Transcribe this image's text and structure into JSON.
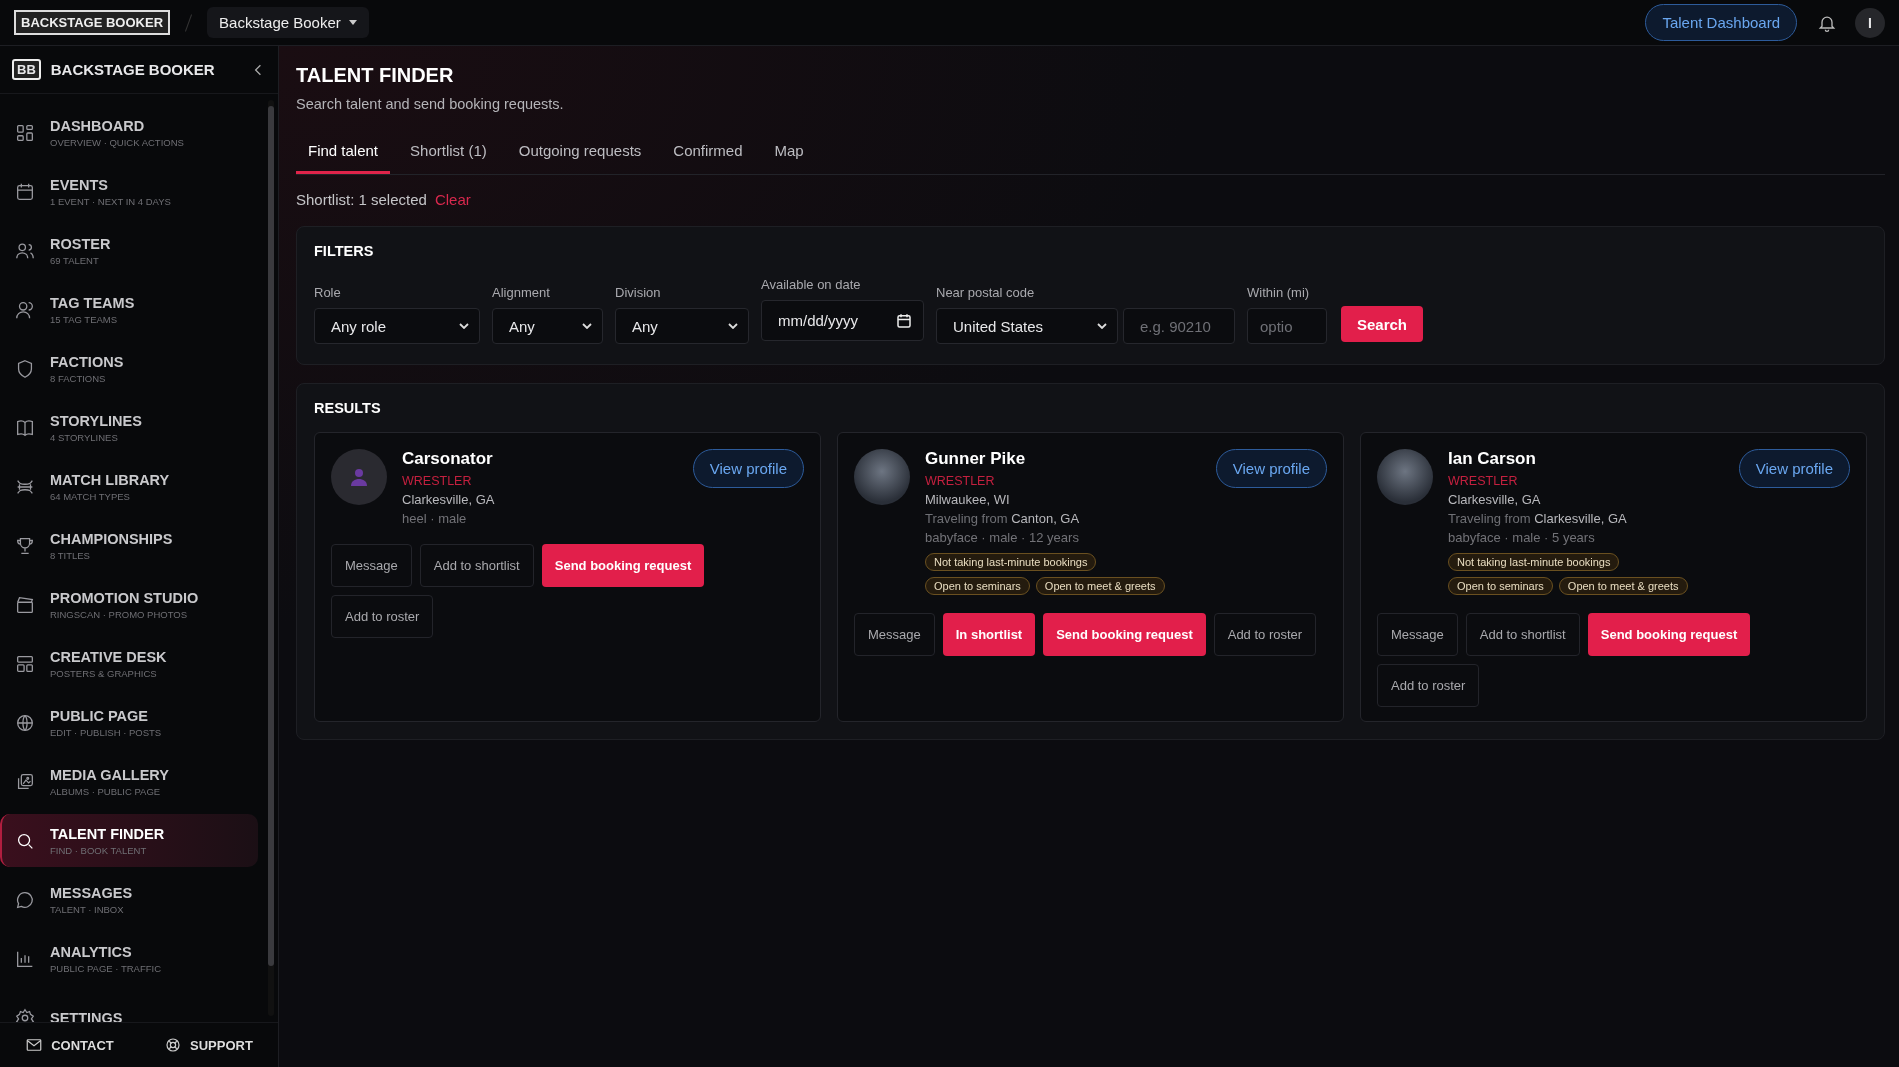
{
  "topbar": {
    "logo": "BACKSTAGE BOOKER",
    "workspace": "Backstage Booker",
    "dashboard_button": "Talent Dashboard",
    "avatar_initial": "I"
  },
  "sidebar": {
    "badge": "BB",
    "brand": "BACKSTAGE BOOKER",
    "items": [
      {
        "title": "DASHBOARD",
        "sub": "OVERVIEW · QUICK ACTIONS",
        "selected": false
      },
      {
        "title": "EVENTS",
        "sub": "1 EVENT · NEXT IN 4 DAYS",
        "selected": false
      },
      {
        "title": "ROSTER",
        "sub": "69 TALENT",
        "selected": false
      },
      {
        "title": "TAG TEAMS",
        "sub": "15 TAG TEAMS",
        "selected": false
      },
      {
        "title": "FACTIONS",
        "sub": "8 FACTIONS",
        "selected": false
      },
      {
        "title": "STORYLINES",
        "sub": "4 STORYLINES",
        "selected": false
      },
      {
        "title": "MATCH LIBRARY",
        "sub": "64 MATCH TYPES",
        "selected": false
      },
      {
        "title": "CHAMPIONSHIPS",
        "sub": "8 TITLES",
        "selected": false
      },
      {
        "title": "PROMOTION STUDIO",
        "sub": "RINGSCAN · PROMO PHOTOS",
        "selected": false
      },
      {
        "title": "CREATIVE DESK",
        "sub": "POSTERS & GRAPHICS",
        "selected": false
      },
      {
        "title": "PUBLIC PAGE",
        "sub": "EDIT · PUBLISH · POSTS",
        "selected": false
      },
      {
        "title": "MEDIA GALLERY",
        "sub": "ALBUMS · PUBLIC PAGE",
        "selected": false
      },
      {
        "title": "TALENT FINDER",
        "sub": "FIND · BOOK TALENT",
        "selected": true
      },
      {
        "title": "MESSAGES",
        "sub": "TALENT · INBOX",
        "selected": false
      },
      {
        "title": "ANALYTICS",
        "sub": "PUBLIC PAGE · TRAFFIC",
        "selected": false
      },
      {
        "title": "SETTINGS",
        "selected": false
      }
    ],
    "footer": [
      {
        "label": "CONTACT"
      },
      {
        "label": "SUPPORT"
      }
    ]
  },
  "page": {
    "title": "TALENT FINDER",
    "subtitle": "Search talent and send booking requests.",
    "tabs": [
      {
        "label": "Find talent",
        "selected": true
      },
      {
        "label": "Shortlist (1)",
        "selected": false
      },
      {
        "label": "Outgoing requests",
        "selected": false
      },
      {
        "label": "Confirmed",
        "selected": false
      },
      {
        "label": "Map",
        "selected": false
      }
    ],
    "shortlist": {
      "text": "Shortlist: 1 selected",
      "clear": "Clear"
    },
    "filters": {
      "title": "FILTERS",
      "groups": [
        {
          "label": "Role",
          "controls": [
            {
              "kind": "select",
              "value": "Any role"
            }
          ]
        },
        {
          "label": "Alignment",
          "controls": [
            {
              "kind": "select",
              "value": "Any"
            }
          ]
        },
        {
          "label": "Division",
          "controls": [
            {
              "kind": "select",
              "value": "Any"
            }
          ]
        },
        {
          "label": "Available on date",
          "controls": [
            {
              "kind": "date",
              "value": "mm/dd/yyyy"
            }
          ]
        },
        {
          "label": "Near postal code",
          "controls": [
            {
              "kind": "select",
              "value": "United States"
            },
            {
              "kind": "text",
              "placeholder": "e.g. 90210"
            }
          ]
        },
        {
          "label": "Within (mi)",
          "controls": [
            {
              "kind": "text",
              "placeholder": "optio"
            }
          ]
        }
      ],
      "search_button": "Search"
    },
    "results": {
      "title": "RESULTS",
      "cards": [
        {
          "name": "Carsonator",
          "role": "WRESTLER",
          "kind": "placeholder",
          "location": "Clarkesville, GA",
          "details": "heel · male",
          "actions": [
            {
              "label": "Message",
              "kind": "outline"
            },
            {
              "label": "Add to shortlist",
              "kind": "outline"
            },
            {
              "label": "Send booking request",
              "kind": "primary"
            },
            {
              "label": "Add to roster",
              "kind": "outline"
            }
          ],
          "view": "View profile"
        },
        {
          "name": "Gunner Pike",
          "role": "WRESTLER",
          "kind": "photo",
          "location": "Milwaukee, WI",
          "travel_label": "Traveling from",
          "travel_city": "Canton, GA",
          "details": "babyface · male · 12 years",
          "tags": [
            "Not taking last-minute bookings",
            "Open to seminars",
            "Open to meet & greets"
          ],
          "actions": [
            {
              "label": "Message",
              "kind": "outline"
            },
            {
              "label": "In shortlist",
              "kind": "primary"
            },
            {
              "label": "Send booking request",
              "kind": "primary"
            },
            {
              "label": "Add to roster",
              "kind": "outline"
            }
          ],
          "view": "View profile"
        },
        {
          "name": "Ian Carson",
          "role": "WRESTLER",
          "kind": "photo",
          "location": "Clarkesville, GA",
          "travel_label": "Traveling from",
          "travel_city": "Clarkesville, GA",
          "details": "babyface · male · 5 years",
          "tags": [
            "Not taking last-minute bookings",
            "Open to seminars",
            "Open to meet & greets"
          ],
          "actions": [
            {
              "label": "Message",
              "kind": "outline"
            },
            {
              "label": "Add to shortlist",
              "kind": "outline"
            },
            {
              "label": "Send booking request",
              "kind": "primary"
            },
            {
              "label": "Add to roster",
              "kind": "outline"
            }
          ],
          "view": "View profile"
        }
      ]
    }
  }
}
